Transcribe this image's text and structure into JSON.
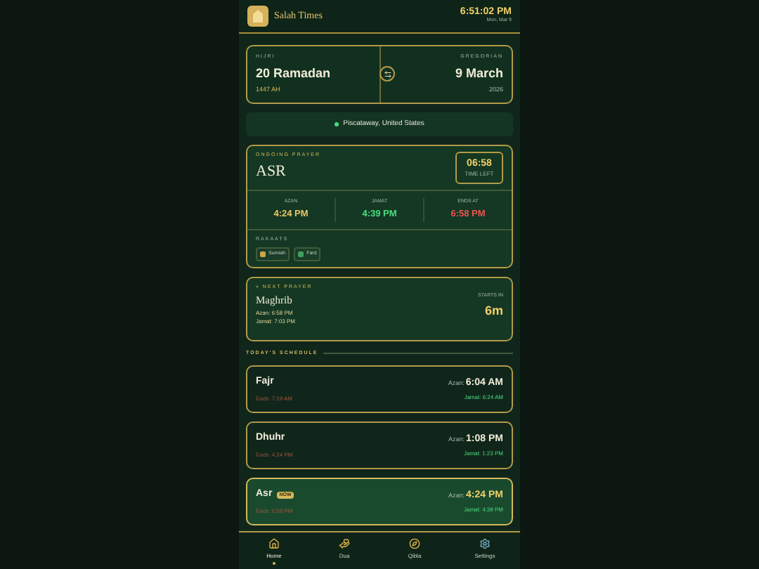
{
  "header": {
    "title": "Salah Times",
    "time": "6:51:02 PM",
    "date": "Mon, Mar 9"
  },
  "dates": {
    "hijri_label": "HIJRI",
    "hijri": "20 Ramadan",
    "hijri_year": "1447 AH",
    "gregorian_label": "GREGORIAN",
    "gregorian": "9 March",
    "gregorian_year": "2026"
  },
  "location": "Piscataway, United States",
  "ongoing": {
    "label": "ONGOING PRAYER",
    "name": "ASR",
    "countdown": "06:58",
    "countdown_label": "TIME LEFT",
    "times": [
      {
        "label": "AZAN",
        "value": "4:24 PM",
        "kind": "azan"
      },
      {
        "label": "JAMAT",
        "value": "4:39 PM",
        "kind": "jamat"
      },
      {
        "label": "ENDS AT",
        "value": "6:58 PM",
        "kind": "ends"
      }
    ],
    "rakaats_label": "RAKAATS",
    "rakaats": [
      {
        "label": "Sunnah",
        "kind": "sunnah"
      },
      {
        "label": "Fard",
        "kind": "fard"
      }
    ]
  },
  "next": {
    "label": "» NEXT PRAYER",
    "name": "Maghrib",
    "azan": "Azan: 6:58 PM",
    "jamat": "Jamat: 7:03 PM",
    "starts_label": "STARTS IN",
    "starts": "6m"
  },
  "schedule_label": "TODAY'S SCHEDULE",
  "schedule": [
    {
      "name": "Fajr",
      "ends": "Ends: 7:19 AM",
      "azan_label": "Azan:",
      "azan": "6:04 AM",
      "jamat": "Jamat: 6:24 AM",
      "selected": false
    },
    {
      "name": "Dhuhr",
      "ends": "Ends: 4:24 PM",
      "azan_label": "Azan:",
      "azan": "1:08 PM",
      "jamat": "Jamat: 1:23 PM",
      "selected": false
    },
    {
      "name": "Asr",
      "badge": "NOW",
      "ends": "Ends: 6:58 PM",
      "azan_label": "Azan:",
      "azan": "4:24 PM",
      "jamat": "Jamat: 4:39 PM",
      "selected": true
    }
  ],
  "nav": [
    {
      "label": "Home",
      "kind": "home",
      "selected": true
    },
    {
      "label": "Dua",
      "kind": "dua",
      "selected": false
    },
    {
      "label": "Qibla",
      "kind": "qibla",
      "selected": false
    },
    {
      "label": "Settings",
      "kind": "settings",
      "selected": false
    }
  ]
}
